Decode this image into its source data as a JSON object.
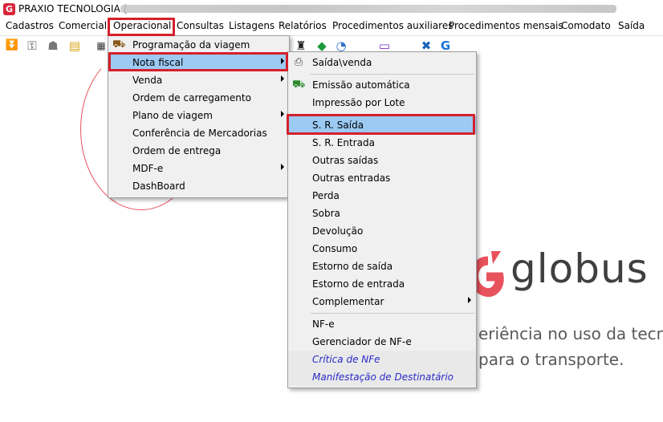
{
  "window": {
    "title": "PRAXIO TECNOLOGIA (",
    "app_icon_letter": "G"
  },
  "menubar": {
    "items": [
      "Cadastros",
      "Comercial",
      "Operacional",
      "Consultas",
      "Listagens",
      "Relatórios",
      "Procedimentos auxiliares",
      "Procedimentos mensais",
      "Comodato",
      "Saída"
    ]
  },
  "operacional_menu": {
    "items": [
      {
        "label": "Programação da viagem",
        "submenu": false
      },
      {
        "label": "Nota fiscal",
        "submenu": true
      },
      {
        "label": "Venda",
        "submenu": true
      },
      {
        "label": "Ordem de carregamento",
        "submenu": false
      },
      {
        "label": "Plano de viagem",
        "submenu": true
      },
      {
        "label": "Conferência de Mercadorias",
        "submenu": false
      },
      {
        "label": "Ordem de entrega",
        "submenu": false
      },
      {
        "label": "MDF-e",
        "submenu": true
      },
      {
        "label": "DashBoard",
        "submenu": false
      }
    ]
  },
  "nota_fiscal_menu": {
    "items": [
      {
        "label": "Saída\\venda"
      },
      {
        "label": "Emissão automática"
      },
      {
        "label": "Impressão por Lote"
      },
      {
        "label": "S. R. Saída"
      },
      {
        "label": "S. R. Entrada"
      },
      {
        "label": "Outras saídas"
      },
      {
        "label": "Outras entradas"
      },
      {
        "label": "Perda"
      },
      {
        "label": "Sobra"
      },
      {
        "label": "Devolução"
      },
      {
        "label": "Consumo"
      },
      {
        "label": "Estorno de saída"
      },
      {
        "label": "Estorno de entrada"
      },
      {
        "label": "Complementar"
      },
      {
        "label": "NF-e"
      },
      {
        "label": "Gerenciador de NF-e"
      },
      {
        "label": "Crítica de NFe"
      },
      {
        "label": "Manifestação de Destinatário"
      }
    ]
  },
  "background": {
    "logo_text": "globus",
    "tagline_1": "eriência no uso da tecno",
    "tagline_2": "para o transporte."
  },
  "colors": {
    "highlight_box": "#d4202c",
    "selected_item": "#9ccaf3",
    "link_item": "#2a2ac8",
    "brand_red": "#d9263a"
  }
}
